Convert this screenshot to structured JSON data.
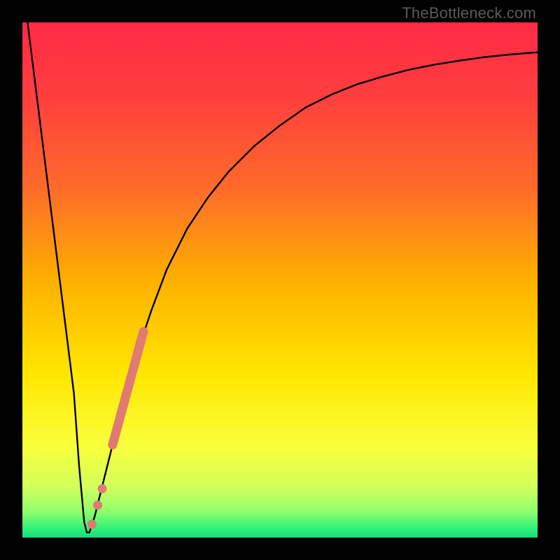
{
  "watermark": {
    "text": "TheBottleneck.com"
  },
  "frame_color": "#000000",
  "gradient_stops": [
    {
      "offset": 0.0,
      "color": "#ff2a46"
    },
    {
      "offset": 0.14,
      "color": "#ff3e3e"
    },
    {
      "offset": 0.32,
      "color": "#ff6a2a"
    },
    {
      "offset": 0.5,
      "color": "#ffb000"
    },
    {
      "offset": 0.68,
      "color": "#ffe600"
    },
    {
      "offset": 0.82,
      "color": "#faff3a"
    },
    {
      "offset": 0.9,
      "color": "#d4ff5a"
    },
    {
      "offset": 0.95,
      "color": "#8dff6e"
    },
    {
      "offset": 0.985,
      "color": "#28f07a"
    },
    {
      "offset": 1.0,
      "color": "#1dd97b"
    }
  ],
  "curve_color": "#000000",
  "marker_color": "#e17a72",
  "chart_data": {
    "type": "line",
    "title": "",
    "xlabel": "",
    "ylabel": "",
    "xlim": [
      0,
      100
    ],
    "ylim": [
      0,
      100
    ],
    "grid": false,
    "series": [
      {
        "name": "bottleneck-curve",
        "x": [
          1,
          2,
          4,
          6,
          8,
          10,
          11,
          12,
          12.5,
          13,
          14,
          16,
          18,
          20,
          22,
          25,
          28,
          32,
          36,
          40,
          45,
          50,
          55,
          60,
          65,
          70,
          75,
          80,
          85,
          90,
          95,
          100
        ],
        "y": [
          100,
          92,
          76,
          60,
          44,
          28,
          14,
          3,
          1,
          1,
          4,
          12,
          20,
          28,
          35,
          44,
          52,
          60,
          66,
          71,
          76,
          80,
          83.5,
          86,
          88,
          89.5,
          90.8,
          91.8,
          92.6,
          93.3,
          93.8,
          94.2
        ]
      }
    ],
    "markers": {
      "segment": {
        "x_start": 17.5,
        "y_start": 18,
        "x_end": 23.5,
        "y_end": 40
      },
      "dots": [
        {
          "x": 15.5,
          "y": 9.5
        },
        {
          "x": 14.6,
          "y": 6.3
        },
        {
          "x": 13.5,
          "y": 2.6
        }
      ]
    },
    "annotations": [
      {
        "text": "TheBottleneck.com",
        "x": 80,
        "y": 100,
        "role": "watermark"
      }
    ]
  }
}
